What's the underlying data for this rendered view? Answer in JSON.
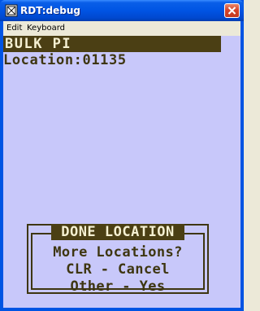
{
  "window": {
    "title": "RDT:debug",
    "icon": "app-icon",
    "close_icon": "close-icon"
  },
  "menu": {
    "items": [
      "Edit",
      "Keyboard"
    ]
  },
  "screen": {
    "header": "BULK PI",
    "location_label": "Location:",
    "location_value": "01135",
    "location_line": "Location:01135",
    "dialog": {
      "title": "DONE LOCATION",
      "line1": "More Locations?",
      "line2": "CLR - Cancel",
      "line3": "Other - Yes"
    }
  },
  "colors": {
    "screen_bg": "#c8c8fa",
    "header_bg": "#4b3f14",
    "text_dark": "#3e3611",
    "text_light": "#f5f0d2"
  }
}
